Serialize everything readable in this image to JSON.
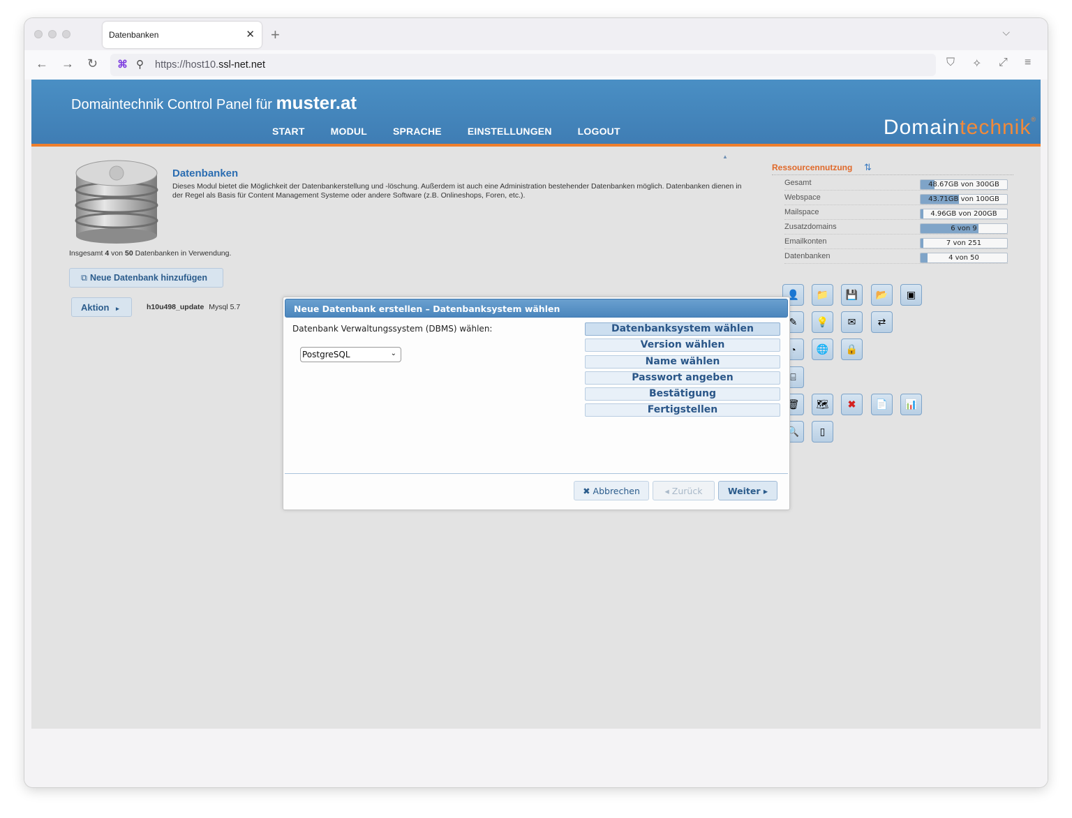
{
  "browser": {
    "tab_title": "Datenbanken",
    "close_glyph": "✕",
    "new_tab_glyph": "+",
    "url_scheme": "https://host10.",
    "url_host": "ssl-net.net",
    "tab_list_glyph": "⌵"
  },
  "header": {
    "title_prefix": "Domaintechnik Control Panel für",
    "title_domain": "muster.at",
    "nav": [
      "START",
      "MODUL",
      "SPRACHE",
      "EINSTELLUNGEN",
      "LOGOUT"
    ],
    "brand_main": "Domain",
    "brand_accent": "technik",
    "brand_mark": "®"
  },
  "module": {
    "title": "Datenbanken",
    "description": "Dieses Modul bietet die Möglichkeit der Datenbankerstellung und -löschung. Außerdem ist auch eine Administration bestehender Datenbanken möglich. Datenbanken dienen in der Regel als Basis für Content Management Systeme oder andere Software (z.B. Onlineshops, Foren, etc.).",
    "usage_prefix": "Insgesamt",
    "usage_used": "4",
    "usage_mid": "von",
    "usage_total": "50",
    "usage_suffix": "Datenbanken in Verwendung.",
    "add_button": "Neue Datenbank hinzufügen",
    "action_button": "Aktion",
    "db_name": "h10u498_update",
    "db_type": "Mysql",
    "db_version": "5.7"
  },
  "resources": {
    "title": "Ressourcennutzung",
    "rows": [
      {
        "label": "Gesamt",
        "value": "48.67GB von 300GB",
        "fraction": 0.16
      },
      {
        "label": "Webspace",
        "value": "43.71GB von 100GB",
        "fraction": 0.44
      },
      {
        "label": "Mailspace",
        "value": "4.96GB von 200GB",
        "fraction": 0.03
      },
      {
        "label": "Zusatzdomains",
        "value": "6 von 9",
        "fraction": 0.67
      },
      {
        "label": "Emailkonten",
        "value": "7 von 251",
        "fraction": 0.03
      },
      {
        "label": "Datenbanken",
        "value": "4 von 50",
        "fraction": 0.08
      }
    ]
  },
  "modal": {
    "title": "Neue Datenbank erstellen – Datenbanksystem wählen",
    "dbms_label": "Datenbank Verwaltungssystem (DBMS) wählen:",
    "dbms_selected": "PostgreSQL",
    "steps": [
      "Datenbanksystem wählen",
      "Version wählen",
      "Name wählen",
      "Passwort angeben",
      "Bestätigung",
      "Fertigstellen"
    ],
    "cancel": "✖ Abbrechen",
    "back": "◂ Zurück",
    "next": "Weiter ▸"
  },
  "colors": {
    "header_blue": "#4a8fc4",
    "accent_orange": "#ee7f2d",
    "link_blue": "#2b6db1"
  },
  "icons": [
    "user-icon",
    "folder-icon",
    "backup-icon",
    "ftp-icon",
    "terminal-icon",
    "tools-icon",
    "bulb-icon",
    "mail-icon",
    "forward-icon",
    "stats-icon",
    "globe-icon",
    "lock-icon",
    "file-icon",
    "trash-icon",
    "map-icon",
    "delete-icon",
    "doc-icon",
    "chart-icon",
    "search-icon",
    "page-icon"
  ]
}
